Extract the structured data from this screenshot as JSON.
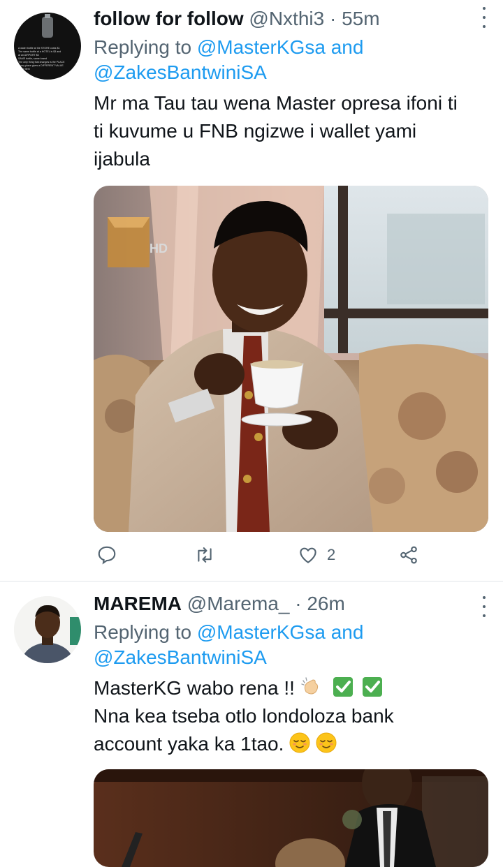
{
  "tweets": [
    {
      "display_name": "follow for follow",
      "handle": "@Nxthi3",
      "separator": "·",
      "time": "55m",
      "replying_prefix": "Replying to",
      "reply_mention_1": "@MasterKGsa",
      "reply_and": "and",
      "reply_mention_2": "@ZakesBantwiniSA",
      "text_lines": [
        "Mr ma Tau tau wena Master opresa ifoni ti",
        "ti kuvume u FNB ngizwe i wallet yami",
        "ijabula"
      ],
      "tv_logo_text": "HD",
      "avatar_text_lines": [
        "A water bottle at the STORE costs $1",
        "The same bottle at a HOTEL is $3 and",
        "at an AIRPORT $5",
        "SAME bottle, same brand",
        "The only thing that changes is the PLACE",
        "Every place gives a DIFFERENT VALUE",
        "to the item"
      ],
      "actions": {
        "reply_count": "",
        "retweet_count": "",
        "like_count": "2"
      }
    },
    {
      "display_name": "MAREMA",
      "handle": "@Marema_",
      "separator": "·",
      "time": "26m",
      "replying_prefix": "Replying to",
      "reply_mention_1": "@MasterKGsa",
      "reply_and": "and",
      "reply_mention_2": "@ZakesBantwiniSA",
      "text_line_1": "MasterKG wabo rena !!",
      "text_line_2": "Nna kea tseba otlo londoloza bank",
      "text_line_3": "account yaka ka 1tao."
    }
  ],
  "colors": {
    "text_primary": "#0f1419",
    "text_secondary": "#536471",
    "link": "#1d9bf0",
    "divider": "#e1e5e8",
    "check_emoji": "#4caf50"
  },
  "icons": [
    "more-icon",
    "reply-icon",
    "retweet-icon",
    "like-icon",
    "share-icon",
    "clap-emoji",
    "check-emoji",
    "relieved-emoji"
  ]
}
